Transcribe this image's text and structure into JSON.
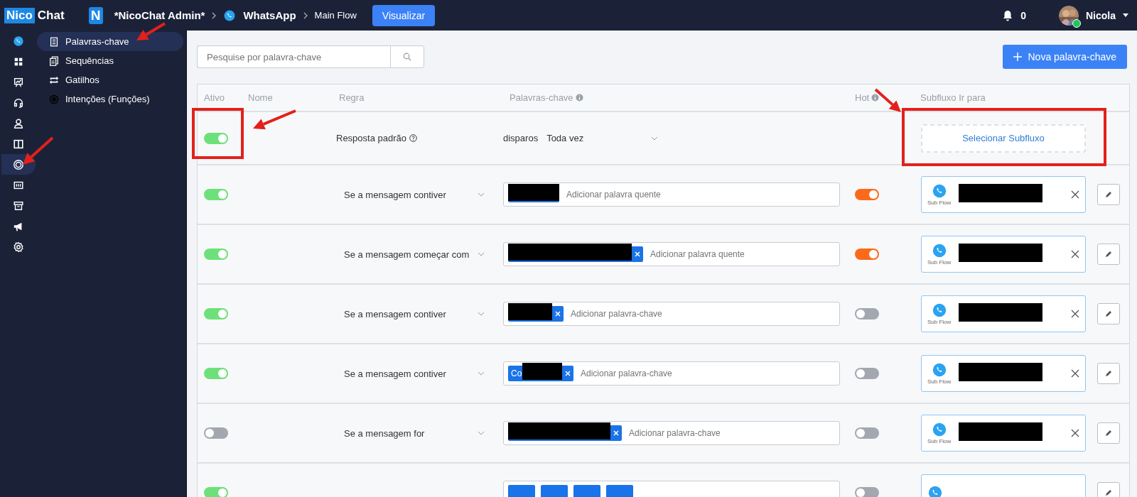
{
  "topbar": {
    "logo": [
      "Nico",
      "Chat"
    ],
    "app_badge": "N",
    "title": "*NicoChat Admin*",
    "breadcrumbs": [
      "WhatsApp",
      "Main Flow"
    ],
    "view_button": "Visualizar",
    "notifications": "0",
    "user": "Nicola"
  },
  "rail": [
    {
      "selected": false
    },
    {
      "selected": false
    },
    {
      "selected": false
    },
    {
      "selected": false
    },
    {
      "selected": false
    },
    {
      "selected": false
    },
    {
      "selected": true
    },
    {
      "selected": false
    },
    {
      "selected": false
    },
    {
      "selected": false
    },
    {
      "selected": false
    }
  ],
  "submenu": [
    {
      "label": "Palavras-chave",
      "selected": true
    },
    {
      "label": "Sequências",
      "selected": false
    },
    {
      "label": "Gatilhos",
      "selected": false
    },
    {
      "label": "Intenções (Funções)",
      "selected": false
    }
  ],
  "search": {
    "placeholder": "Pesquise por palavra-chave"
  },
  "new_button": "Nova palavra-chave",
  "table": {
    "columns": [
      {
        "label": "Ativo",
        "info": false
      },
      {
        "label": "Nome",
        "info": false
      },
      {
        "label": "Regra",
        "info": false
      },
      {
        "label": "Palavras-chave",
        "info": true
      },
      {
        "label": "Hot",
        "info": true
      },
      {
        "label": "Subfluxo Ir para",
        "info": false
      }
    ],
    "rows": [
      {
        "kind": "default",
        "active": true,
        "rule": "Resposta padrão",
        "trigger_label": "disparos",
        "trigger": "Toda vez",
        "subflow_button": "Selecionar Subfluxo"
      },
      {
        "kind": "keyword",
        "active": true,
        "rule": "Se a mensagem contiver",
        "chips": [
          {
            "removable": false
          }
        ],
        "input_placeholder": "Adicionar palavra quente",
        "hotword": true,
        "subflow": {
          "caption": "Sub Flow"
        }
      },
      {
        "kind": "keyword",
        "active": true,
        "rule": "Se a mensagem começar com",
        "chips": [
          {
            "removable": true
          }
        ],
        "input_placeholder": "Adicionar palavra quente",
        "hotword": true,
        "subflow": {
          "caption": "Sub Flow"
        }
      },
      {
        "kind": "keyword",
        "active": true,
        "rule": "Se a mensagem contiver",
        "chips": [
          {
            "removable": true
          }
        ],
        "input_placeholder": "Adicionar palavra-chave",
        "hotword": false,
        "subflow": {
          "caption": "Sub Flow"
        }
      },
      {
        "kind": "keyword",
        "active": true,
        "rule": "Se a mensagem contiver",
        "chips": [
          {
            "text": "Co",
            "removable": true
          }
        ],
        "input_placeholder": "Adicionar palavra-chave",
        "hotword": false,
        "subflow": {
          "caption": "Sub Flow"
        }
      },
      {
        "kind": "keyword",
        "active": false,
        "rule": "Se a mensagem for",
        "chips": [
          {
            "removable": true
          }
        ],
        "input_placeholder": "Adicionar palavra-chave",
        "hotword": false,
        "subflow": {
          "caption": "Sub Flow"
        }
      },
      {
        "kind": "partial",
        "active": true,
        "chips": [
          {
            "removable": false
          },
          {
            "removable": false
          },
          {
            "removable": false
          },
          {
            "removable": false
          }
        ],
        "hotword": false
      }
    ]
  }
}
